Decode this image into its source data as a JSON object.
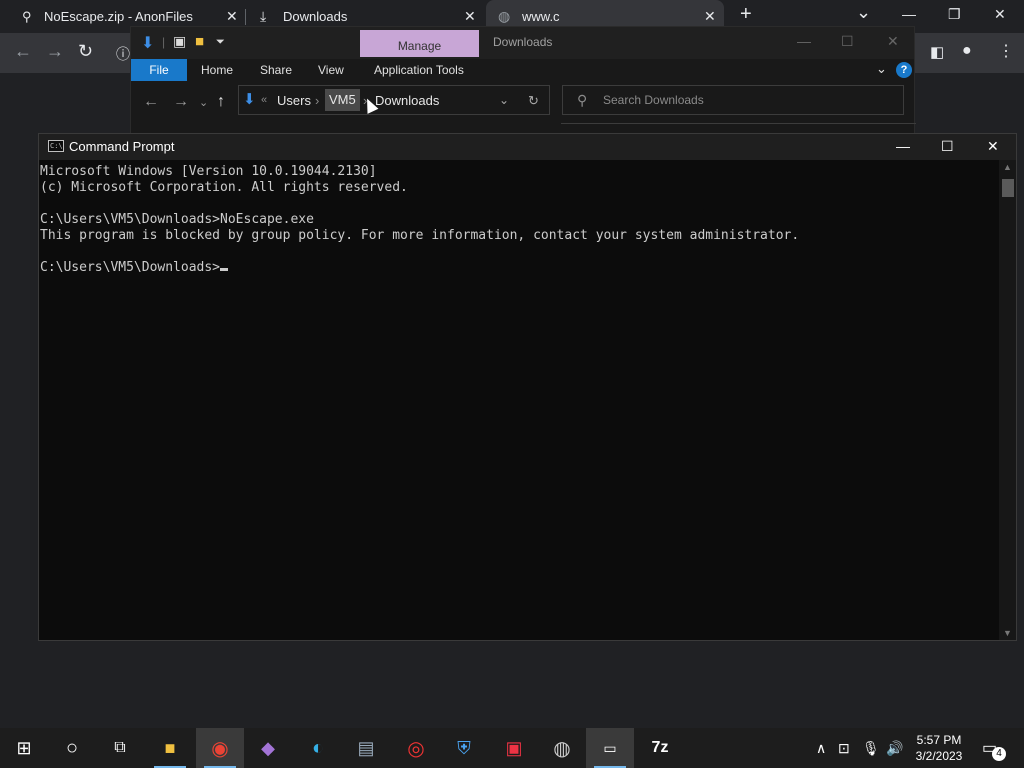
{
  "browser": {
    "tabs": [
      {
        "title": "NoEscape.zip - AnonFiles",
        "icon": "anonfiles-icon"
      },
      {
        "title": "Downloads",
        "icon": "download-icon"
      },
      {
        "title": "www.c",
        "icon": "globe-icon"
      }
    ],
    "new_tab": "+",
    "controls": {
      "minimize": "—",
      "restore": "❐",
      "close": "✕"
    },
    "tab_close": "✕",
    "menu_chevron": "⌄"
  },
  "explorer": {
    "manage_tab": "Manage",
    "title": "Downloads",
    "ribbon": {
      "file": "File",
      "home": "Home",
      "share": "Share",
      "view": "View",
      "app_tools": "Application Tools"
    },
    "breadcrumb": [
      "Users",
      "VM5",
      "Downloads"
    ],
    "breadcrumb_sep": "›",
    "overflow": "«",
    "search_placeholder": "Search Downloads",
    "help": "?"
  },
  "cmd": {
    "title": "Command Prompt",
    "lines": [
      "Microsoft Windows [Version 10.0.19044.2130]",
      "(c) Microsoft Corporation. All rights reserved.",
      "",
      "C:\\Users\\VM5\\Downloads>NoEscape.exe",
      "This program is blocked by group policy. For more information, contact your system administrator.",
      "",
      "C:\\Users\\VM5\\Downloads>"
    ],
    "icon_text": "C:\\"
  },
  "taskbar": {
    "clock_time": "5:57 PM",
    "clock_date": "3/2/2023",
    "notification_count": "4",
    "apps": [
      "start-icon",
      "search-icon",
      "task-view-icon",
      "file-explorer-icon",
      "chrome-icon",
      "visual-studio-icon",
      "edge-icon",
      "media-icon",
      "red-app-icon",
      "shield-app-icon",
      "camera-app-icon",
      "obs-icon",
      "terminal-icon",
      "7zip-icon"
    ],
    "label_7z": "7z"
  },
  "colors": {
    "accent": "#1979ca",
    "manage": "#c8a6d6",
    "console_text": "#cccccc"
  }
}
